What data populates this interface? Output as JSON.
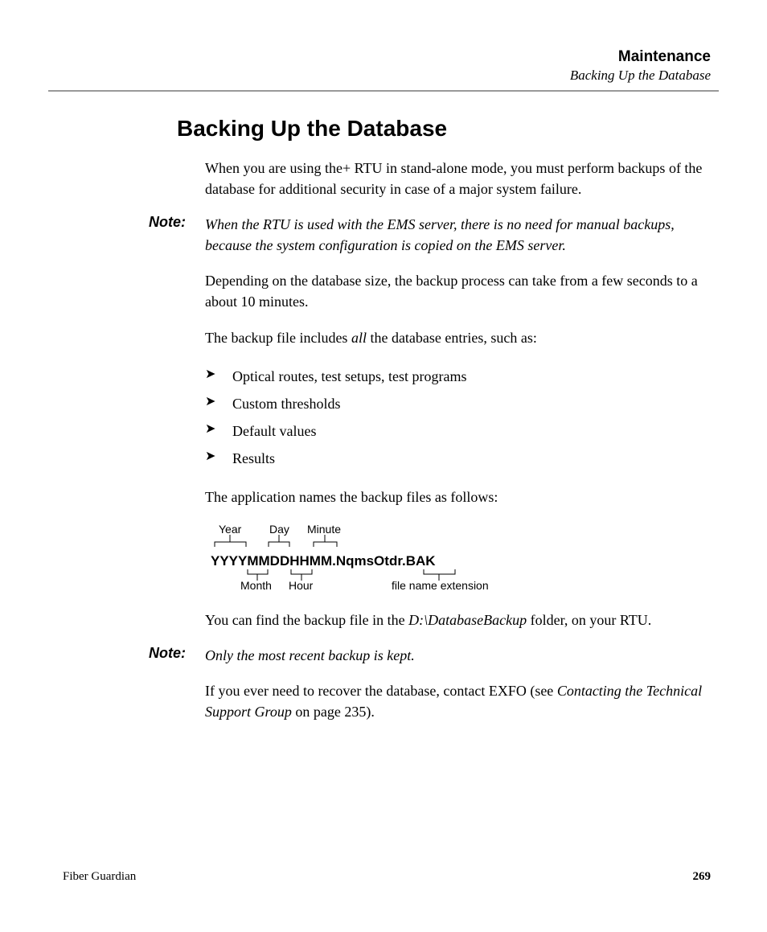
{
  "header": {
    "title": "Maintenance",
    "subtitle": "Backing Up the Database"
  },
  "section_title": "Backing Up the Database",
  "para1": "When you are using the+ RTU in stand-alone mode, you must perform backups of the database for additional security in case of a major system failure.",
  "note1_label": "Note:",
  "note1_text": "When the RTU is used with the EMS server, there is no need for manual backups, because the system configuration is copied on the EMS server.",
  "para2": "Depending on the database size, the backup process can take from a few seconds to a about 10 minutes.",
  "para3_pre": "The backup file includes ",
  "para3_emph": "all",
  "para3_post": " the database entries, such as:",
  "bullets": [
    "Optical routes, test setups, test programs",
    "Custom thresholds",
    "Default values",
    "Results"
  ],
  "para4": "The application names the backup files as follows:",
  "diagram": {
    "top": {
      "year": "Year",
      "day": "Day",
      "minute": "Minute"
    },
    "main": "YYYYMMDDHHMM.NqmsOtdr.BAK",
    "bottom": {
      "month": "Month",
      "hour": "Hour",
      "ext": "file name extension"
    }
  },
  "para5_pre": "You can find the backup file in the ",
  "para5_emph": "D:\\DatabaseBackup",
  "para5_post": " folder, on your RTU.",
  "note2_label": "Note:",
  "note2_text": "Only the most recent backup is kept.",
  "para6_pre": "If you ever need to recover the database, contact EXFO (see ",
  "para6_emph": "Contacting the Technical Support Group",
  "para6_post": " on page 235).",
  "footer": {
    "left": "Fiber Guardian",
    "right": "269"
  }
}
